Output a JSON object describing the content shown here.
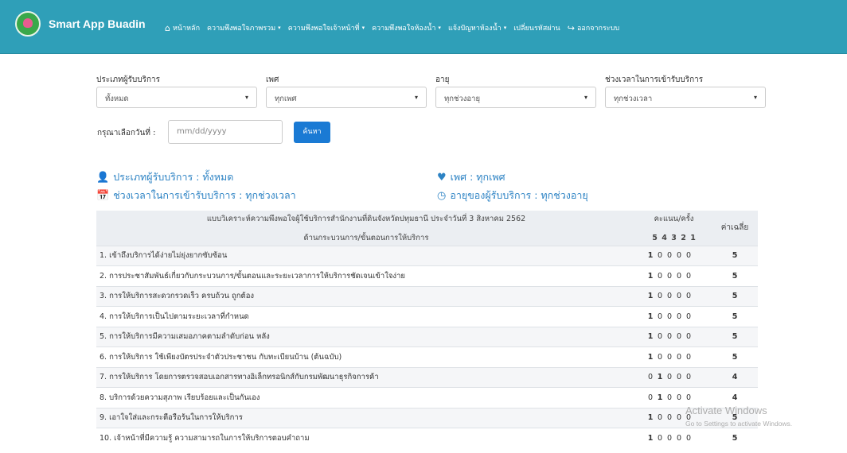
{
  "brand": {
    "name": "Smart App Buadin"
  },
  "nav": [
    {
      "icon": "home-icon",
      "glyph": "⌂",
      "label": "หน้าหลัก",
      "caret": false
    },
    {
      "icon": "",
      "glyph": "",
      "label": "ความพึงพอใจภาพรวม",
      "caret": true
    },
    {
      "icon": "",
      "glyph": "",
      "label": "ความพึงพอใจเจ้าหน้าที่",
      "caret": true
    },
    {
      "icon": "",
      "glyph": "",
      "label": "ความพึงพอใจห้องน้ำ",
      "caret": true
    },
    {
      "icon": "",
      "glyph": "",
      "label": "แจ้งปัญหาห้องน้ำ",
      "caret": true
    },
    {
      "icon": "",
      "glyph": "",
      "label": "เปลี่ยนรหัสผ่าน",
      "caret": false
    },
    {
      "icon": "logout-icon",
      "glyph": "↪",
      "label": "ออกจากระบบ",
      "caret": false
    }
  ],
  "filters": [
    {
      "label": "ประเภทผู้รับบริการ",
      "value": "ทั้งหมด"
    },
    {
      "label": "เพศ",
      "value": "ทุกเพศ"
    },
    {
      "label": "อายุ",
      "value": "ทุกช่วงอายุ"
    },
    {
      "label": "ช่วงเวลาในการเข้ารับบริการ",
      "value": "ทุกช่วงเวลา"
    }
  ],
  "date": {
    "label": "กรุณาเลือกวันที่ :",
    "placeholder": "mm/dd/yyyy",
    "button": "ค้นหา"
  },
  "summary": {
    "service_type": "ประเภทผู้รับบริการ : ทั้งหมด",
    "gender": "เพศ : ทุกเพศ",
    "time": "ช่วงเวลาในการเข้ารับบริการ : ทุกช่วงเวลา",
    "age": "อายุของผู้รับบริการ : ทุกช่วงอายุ"
  },
  "table": {
    "title": "แบบวิเคราะห์ความพึงพอใจผู้ใช้บริการสำนักงานที่ดินจังหวัดปทุมธานี ประจำวันที่ 3 สิงหาคม 2562",
    "subtitle": "ด้านกระบวนการ/ขั้นตอนการให้บริการ",
    "score_header": "คะแนน/ครั้ง",
    "score_levels": [
      "5",
      "4",
      "3",
      "2",
      "1"
    ],
    "avg_header": "ค่าเฉลี่ย",
    "rows": [
      {
        "q": "1. เข้าถึงบริการได้ง่ายไม่ยุ่งยากซับซ้อน",
        "scores": [
          "1",
          "0",
          "0",
          "0",
          "0"
        ],
        "avg": "5"
      },
      {
        "q": "2. การประชาสัมพันธ์เกี่ยวกับกระบวนการ/ขั้นตอนและระยะเวลาการให้บริการชัดเจนเข้าใจง่าย",
        "scores": [
          "1",
          "0",
          "0",
          "0",
          "0"
        ],
        "avg": "5"
      },
      {
        "q": "3. การให้บริการสะดวกรวดเร็ว ครบถ้วน ถูกต้อง",
        "scores": [
          "1",
          "0",
          "0",
          "0",
          "0"
        ],
        "avg": "5"
      },
      {
        "q": "4. การให้บริการเป็นไปตามระยะเวลาที่กำหนด",
        "scores": [
          "1",
          "0",
          "0",
          "0",
          "0"
        ],
        "avg": "5"
      },
      {
        "q": "5. การให้บริการมีความเสมอภาคตามลำดับก่อน หลัง",
        "scores": [
          "1",
          "0",
          "0",
          "0",
          "0"
        ],
        "avg": "5"
      },
      {
        "q": "6. การให้บริการ ใช้เพียงบัตรประจำตัวประชาชน กับทะเบียนบ้าน (ต้นฉบับ)",
        "scores": [
          "1",
          "0",
          "0",
          "0",
          "0"
        ],
        "avg": "5"
      },
      {
        "q": "7. การให้บริการ โดยการตรวจสอบเอกสารทางอิเล็กทรอนิกส์กับกรมพัฒนาธุรกิจการค้า",
        "scores": [
          "0",
          "1",
          "0",
          "0",
          "0"
        ],
        "avg": "4"
      },
      {
        "q": "8. บริการด้วยความสุภาพ เรียบร้อยและเป็นกันเอง",
        "scores": [
          "0",
          "1",
          "0",
          "0",
          "0"
        ],
        "avg": "4"
      },
      {
        "q": "9. เอาใจใส่และกระตือรือร้นในการให้บริการ",
        "scores": [
          "1",
          "0",
          "0",
          "0",
          "0"
        ],
        "avg": "5"
      },
      {
        "q": "10. เจ้าหน้าที่มีความรู้ ความสามารถในการให้บริการตอบคำถาม",
        "scores": [
          "1",
          "0",
          "0",
          "0",
          "0"
        ],
        "avg": "5"
      }
    ]
  },
  "watermark": {
    "title": "Activate Windows",
    "subtitle": "Go to Settings to activate Windows."
  }
}
